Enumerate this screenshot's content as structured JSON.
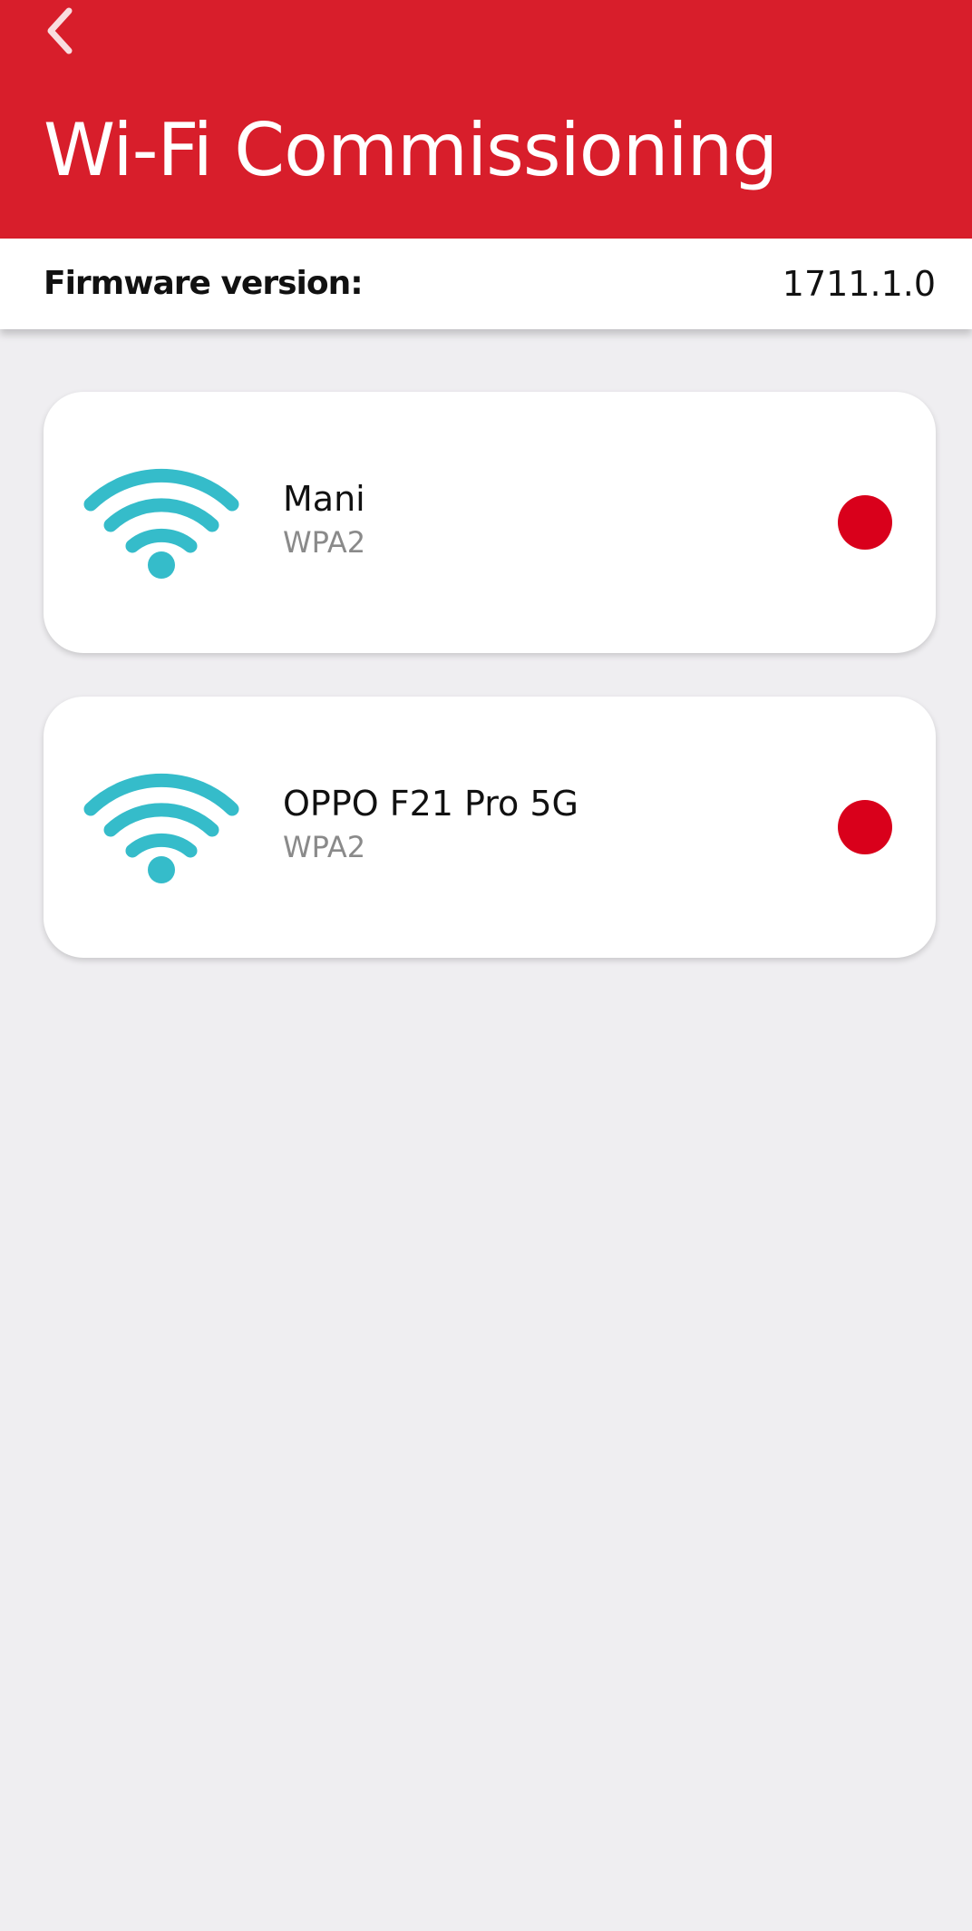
{
  "header": {
    "back_icon": "chevron-left-icon",
    "title": "Wi-Fi Commissioning",
    "background_color": "#d81e2b"
  },
  "firmware": {
    "label": "Firmware version:",
    "value": "1711.1.0"
  },
  "networks": [
    {
      "icon": "wifi-icon",
      "name": "Mani",
      "security": "WPA2",
      "status_color": "#d9001b"
    },
    {
      "icon": "wifi-icon",
      "name": "OPPO F21 Pro 5G",
      "security": "WPA2",
      "status_color": "#d9001b"
    }
  ],
  "colors": {
    "accent": "#d81e2b",
    "wifi_icon": "#35bcca",
    "status_dot": "#d9001b",
    "background": "#efeef1"
  }
}
